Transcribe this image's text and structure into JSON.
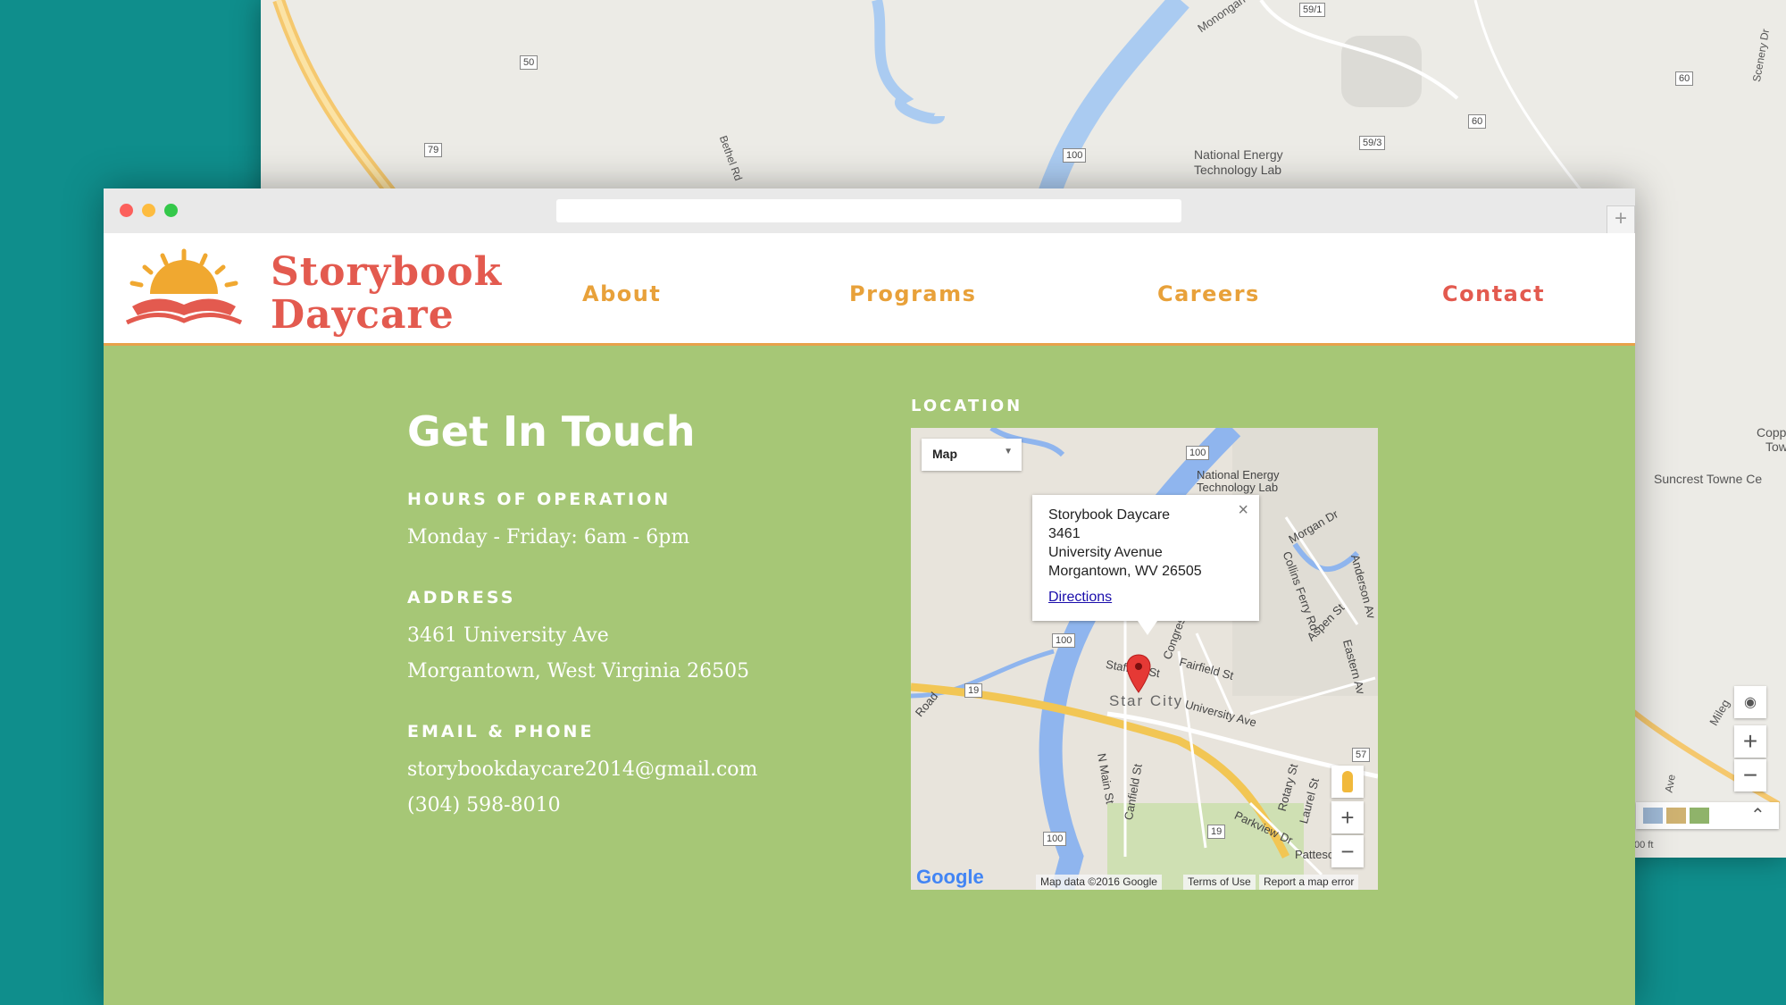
{
  "site": {
    "brand_line1": "Storybook",
    "brand_line2": "Daycare",
    "nav": [
      {
        "label": "About",
        "active": false
      },
      {
        "label": "Programs",
        "active": false
      },
      {
        "label": "Careers",
        "active": false
      },
      {
        "label": "Contact",
        "active": true
      }
    ]
  },
  "contact": {
    "title": "Get In Touch",
    "hours_label": "HOURS OF OPERATION",
    "hours": "Monday - Friday: 6am - 6pm",
    "address_label": "ADDRESS",
    "address_line1": "3461 University Ave",
    "address_line2": "Morgantown, West Virginia 26505",
    "email_phone_label": "EMAIL & PHONE",
    "email": "storybookdaycare2014@gmail.com",
    "phone": "(304) 598-8010"
  },
  "location": {
    "label": "LOCATION",
    "map_type": "Map",
    "info": {
      "name": "Storybook Daycare",
      "line1": "3461",
      "line2": "University Avenue",
      "line3": "Morgantown, WV 26505",
      "directions": "Directions"
    },
    "streets": {
      "energy_lab": "National Energy Technology Lab",
      "morgan_dr": "Morgan Dr",
      "collins_ferry": "Collins Ferry Rd",
      "aspen": "Aspen St",
      "anderson": "Anderson Av",
      "eastern": "Eastern Av",
      "fairfield": "Fairfield St",
      "stafford": "Stafford St",
      "congress": "Congress",
      "star_city": "Star City",
      "university": "University Ave",
      "n_main": "N Main St",
      "canfield": "Canfield St",
      "laurel": "Laurel St",
      "rotary": "Rotary St",
      "parkview": "Parkview Dr",
      "patteson": "Patteso",
      "road": "Road",
      "r100a": "100",
      "r100b": "100",
      "r100c": "100",
      "r19a": "19",
      "r19b": "19",
      "r57": "57"
    },
    "footer": {
      "google": "Google",
      "mapdata": "Map data ©2016 Google",
      "terms": "Terms of Use",
      "report": "Report a map error"
    }
  },
  "background_map": {
    "labels": {
      "energy_lab": "National Energy Technology Lab",
      "monongahela": "Monongah",
      "bethel": "Bethel Rd",
      "scenery": "Scenery Dr",
      "suncrest": "Suncrest Towne Ce",
      "copp": "Copp",
      "tow": "Tow",
      "scale": "00 ft",
      "mileg": "Mileg",
      "ave": "Ave"
    },
    "routes": {
      "r50": "50",
      "r79": "79",
      "r100": "100",
      "r59_1": "59/1",
      "r59_3": "59/3",
      "r60a": "60",
      "r60b": "60"
    }
  },
  "colors": {
    "background": "#0f8e8c",
    "page_green": "#a6c776",
    "brand_red": "#e35a4f",
    "nav_orange": "#e8a13a"
  }
}
